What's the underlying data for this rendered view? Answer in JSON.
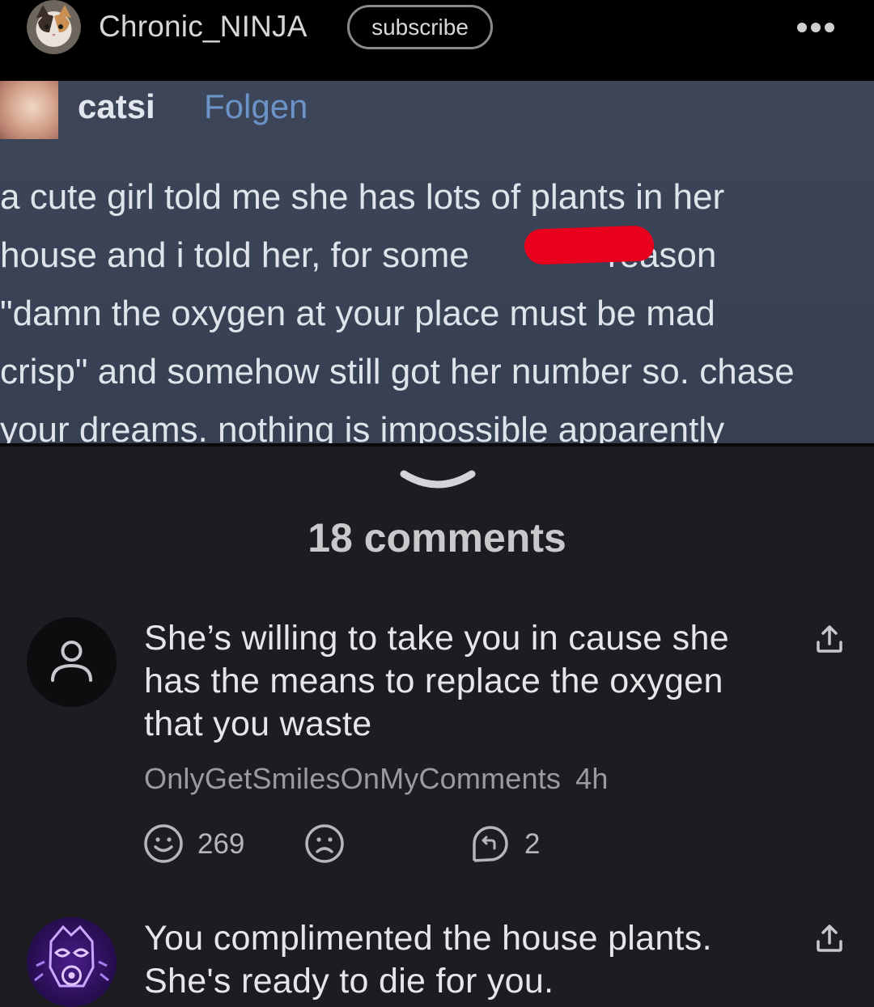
{
  "header": {
    "author": "Chronic_NINJA",
    "subscribe_label": "subscribe"
  },
  "post_image": {
    "username": "catsi",
    "follow_label": "Folgen",
    "text_lines": [
      "a cute girl told me she has lots of plants in her",
      "house and i told her, for some              reason",
      "\"damn the oxygen at your place must be mad",
      "crisp\" and somehow still got her number so. chase",
      "your dreams. nothing is impossible apparently"
    ]
  },
  "comments_section": {
    "count_label": "18 comments"
  },
  "comments": [
    {
      "text": "She’s willing to take you in cause she has the means to replace the oxygen that you waste",
      "author": "OnlyGetSmilesOnMyComments",
      "time": "4h",
      "likes": "269",
      "replies": "2"
    },
    {
      "text": "You complimented the house plants. She's ready to die for you."
    }
  ],
  "colors": {
    "background": "#1c1c21",
    "header": "#000000",
    "follow_link": "#6c93c7",
    "redaction": "#e8001c",
    "avatar_purple": "#6a2fd0"
  },
  "icons": [
    "cat-avatar-icon",
    "more-dots-icon",
    "chevron-down-icon",
    "user-placeholder-icon",
    "share-icon",
    "smile-icon",
    "frown-icon",
    "reply-icon",
    "gasmask-avatar-icon"
  ]
}
